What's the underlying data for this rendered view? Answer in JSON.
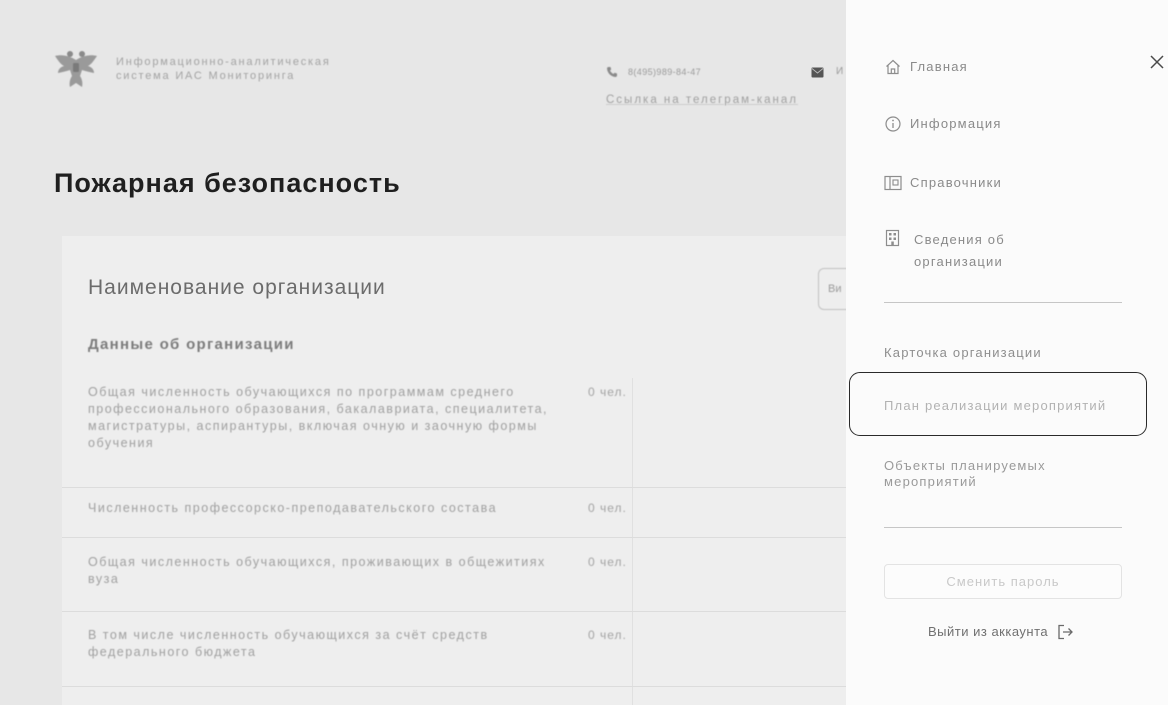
{
  "header": {
    "system_name_lines": [
      "Информационно-аналитическая",
      "система ИАС Мониторинга"
    ],
    "phone": "8(495)989-84-47",
    "email_partial": "И",
    "telegram_link": "Ссылка на телеграм-канал",
    "logo_icon": "emblem-logo",
    "phone_icon": "phone-icon",
    "email_icon": "mail-icon"
  },
  "page": {
    "title": "Пожарная безопасность"
  },
  "card": {
    "title": "Наименование организации",
    "action_button_partial": "Ви",
    "section_title": "Данные об организации",
    "rows": [
      {
        "label_lines": [
          "Общая численность обучающихся по программам среднего",
          "профессионального образования, бакалавриата, специалитета,",
          "магистратуры, аспирантуры, включая очную и заочную формы",
          "обучения"
        ],
        "value": "0 чел."
      },
      {
        "label_lines": [
          "Численность профессорско-преподавательского состава"
        ],
        "value": "0 чел."
      },
      {
        "label_lines": [
          "Общая численность обучающихся, проживающих в общежитиях",
          "вуза"
        ],
        "value": "0 чел."
      },
      {
        "label_lines": [
          "В том числе численность обучающихся за счёт средств",
          "федерального бюджета"
        ],
        "value": "0 чел."
      }
    ]
  },
  "menu": {
    "main_items": [
      {
        "label_lines": [
          "Главная"
        ],
        "icon": "home-icon"
      },
      {
        "label_lines": [
          "Информация"
        ],
        "icon": "info-icon"
      },
      {
        "label_lines": [
          "Справочники"
        ],
        "icon": "book-icon"
      },
      {
        "label_lines": [
          "Сведения об",
          "организации"
        ],
        "icon": "building-icon"
      }
    ],
    "sub_items": [
      {
        "label_lines": [
          "Карточка организации"
        ]
      },
      {
        "label_lines": [
          "План реализации мероприятий"
        ],
        "highlighted": true
      },
      {
        "label_lines": [
          "Объекты планируемых",
          "мероприятий"
        ]
      }
    ],
    "change_password_label": "Сменить пароль",
    "logout_label": "Выйти из аккаунта",
    "logout_icon": "logout-icon",
    "close_icon": "close-icon"
  },
  "colors": {
    "page_background": "#e7e7e7",
    "card_background": "#eeeeee",
    "menu_background": "#fbfbfb",
    "title_text": "#1f1f1f",
    "highlight_outline": "#2a2a2a"
  }
}
